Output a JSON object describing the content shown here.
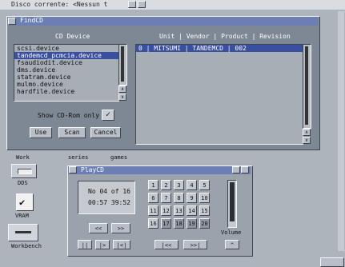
{
  "screen": {
    "title": "Disco corrente: <Nessun t"
  },
  "findcd": {
    "title": "FindCD",
    "device_header": "CD Device",
    "info_header": "Unit | Vendor | Product | Revision",
    "devices": [
      "scsi.device",
      "tandemcd_pcmcia.device",
      "fsaudiodit.device",
      "dms.device",
      "statram.device",
      "mulmo.device",
      "hardfile.device"
    ],
    "selected_device_index": 1,
    "result_row": "0 | MITSUMI   |       TANDEMCD | 002",
    "show_cdrom_only_label": "Show CD-Rom only",
    "show_cdrom_only_checked": true,
    "use_label": "Use",
    "scan_label": "Scan",
    "cancel_label": "Cancel"
  },
  "desktop": {
    "label_left": "Work",
    "label_mid": "series",
    "label_right": "games",
    "icons": [
      "DDS",
      "VRAM",
      "Workbench"
    ]
  },
  "playcd": {
    "title": "PlayCD",
    "track_display": "No 04 of 16",
    "time_display": "00:57 39:52",
    "tracks": [
      "1",
      "2",
      "3",
      "4",
      "5",
      "6",
      "7",
      "8",
      "9",
      "10",
      "11",
      "12",
      "13",
      "14",
      "15",
      "16",
      "17",
      "18",
      "19",
      "20"
    ],
    "total_tracks": 16,
    "volume_label": "Volume",
    "volume_level": 0.9,
    "controls": [
      "<<",
      ">>",
      "||",
      "|>",
      "|<|",
      "|<<",
      ">>|",
      "^"
    ]
  }
}
